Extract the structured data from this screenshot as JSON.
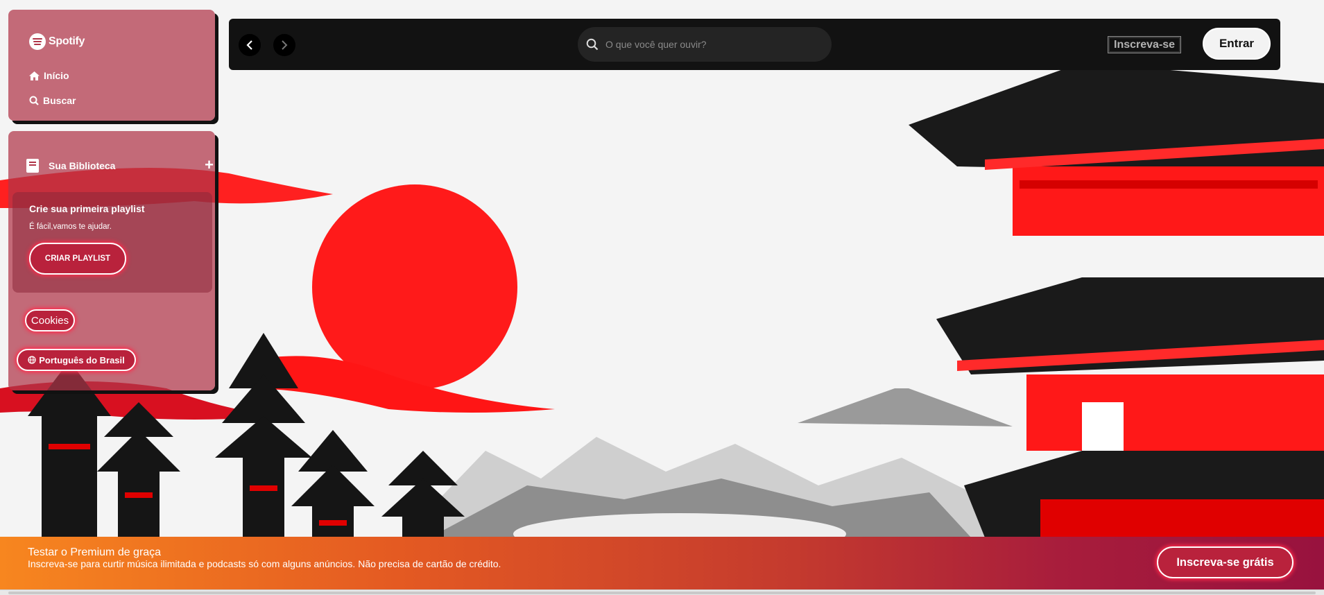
{
  "sidebar": {
    "logo_text": "Spotify",
    "nav": [
      {
        "label": "Início",
        "icon": "home-icon"
      },
      {
        "label": "Buscar",
        "icon": "search-icon"
      }
    ],
    "library": {
      "title": "Sua Biblioteca",
      "add_icon": "plus-icon",
      "card": {
        "title": "Crie sua primeira playlist",
        "subtitle": "É fácil,vamos te ajudar.",
        "button": "CRIAR PLAYLIST"
      },
      "cookies_button": "Cookies",
      "language_button": "Português do Brasil"
    }
  },
  "topbar": {
    "search_placeholder": "O que você quer ouvir?",
    "signup_label": "Inscreva-se",
    "login_label": "Entrar"
  },
  "banner": {
    "title": "Testar o Premium de graça",
    "subtitle": "Inscreva-se para curtir música ilimitada e podcasts só com alguns anúncios. Não precisa de cartão de crédito.",
    "button": "Inscreva-se grátis"
  },
  "colors": {
    "accent_red": "#b9223c",
    "topbar_bg": "#121212",
    "panel_bg": "#b03448"
  }
}
